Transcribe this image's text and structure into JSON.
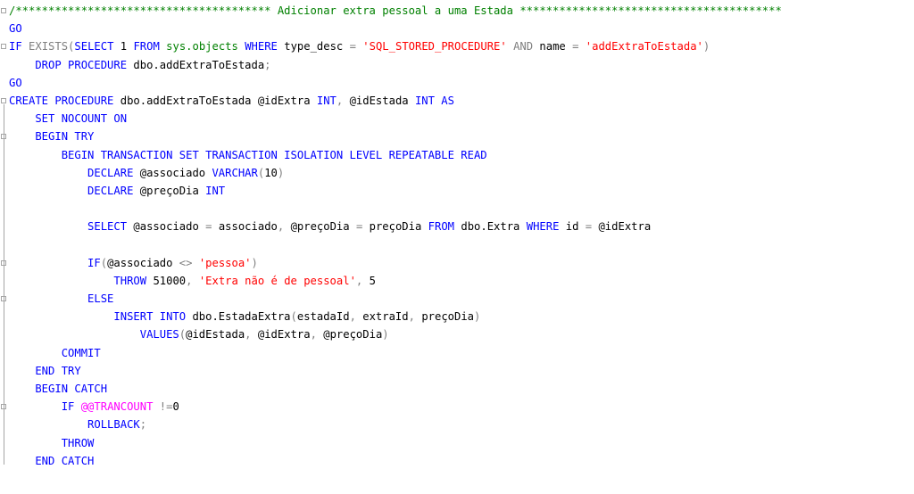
{
  "editor": {
    "lines": [
      [
        {
          "t": "/*************************************** Adicionar extra pessoal a uma Estada ****************************************",
          "c": "cmt"
        }
      ],
      [
        {
          "t": "GO",
          "c": "kw"
        }
      ],
      [
        {
          "t": "IF ",
          "c": "kw"
        },
        {
          "t": "EXISTS",
          "c": "gray"
        },
        {
          "t": "(",
          "c": "gray"
        },
        {
          "t": "SELECT ",
          "c": "kw"
        },
        {
          "t": "1 ",
          "c": "id"
        },
        {
          "t": "FROM ",
          "c": "kw"
        },
        {
          "t": "sys.objects ",
          "c": "sys"
        },
        {
          "t": "WHERE ",
          "c": "kw"
        },
        {
          "t": "type_desc ",
          "c": "id"
        },
        {
          "t": "= ",
          "c": "gray"
        },
        {
          "t": "'SQL_STORED_PROCEDURE' ",
          "c": "str"
        },
        {
          "t": "AND ",
          "c": "gray"
        },
        {
          "t": "name ",
          "c": "id"
        },
        {
          "t": "= ",
          "c": "gray"
        },
        {
          "t": "'addExtraToEstada'",
          "c": "str"
        },
        {
          "t": ")",
          "c": "gray"
        }
      ],
      [
        {
          "t": "    DROP PROCEDURE ",
          "c": "kw"
        },
        {
          "t": "dbo.addExtraToEstada",
          "c": "id"
        },
        {
          "t": ";",
          "c": "gray"
        }
      ],
      [
        {
          "t": "GO",
          "c": "kw"
        }
      ],
      [
        {
          "t": "CREATE PROCEDURE ",
          "c": "kw"
        },
        {
          "t": "dbo.addExtraToEstada @idExtra ",
          "c": "id"
        },
        {
          "t": "INT",
          "c": "kw"
        },
        {
          "t": ", ",
          "c": "gray"
        },
        {
          "t": "@idEstada ",
          "c": "id"
        },
        {
          "t": "INT AS",
          "c": "kw"
        }
      ],
      [
        {
          "t": "    SET NOCOUNT ON",
          "c": "kw"
        }
      ],
      [
        {
          "t": "    BEGIN TRY",
          "c": "kw"
        }
      ],
      [
        {
          "t": "        BEGIN TRANSACTION SET TRANSACTION ISOLATION LEVEL REPEATABLE READ",
          "c": "kw"
        }
      ],
      [
        {
          "t": "            DECLARE ",
          "c": "kw"
        },
        {
          "t": "@associado ",
          "c": "id"
        },
        {
          "t": "VARCHAR",
          "c": "kw"
        },
        {
          "t": "(",
          "c": "gray"
        },
        {
          "t": "10",
          "c": "id"
        },
        {
          "t": ")",
          "c": "gray"
        }
      ],
      [
        {
          "t": "            DECLARE ",
          "c": "kw"
        },
        {
          "t": "@preçoDia ",
          "c": "id"
        },
        {
          "t": "INT",
          "c": "kw"
        }
      ],
      [
        {
          "t": "",
          "c": "id"
        }
      ],
      [
        {
          "t": "            SELECT ",
          "c": "kw"
        },
        {
          "t": "@associado ",
          "c": "id"
        },
        {
          "t": "= ",
          "c": "gray"
        },
        {
          "t": "associado",
          "c": "id"
        },
        {
          "t": ", ",
          "c": "gray"
        },
        {
          "t": "@preçoDia ",
          "c": "id"
        },
        {
          "t": "= ",
          "c": "gray"
        },
        {
          "t": "preçoDia ",
          "c": "id"
        },
        {
          "t": "FROM ",
          "c": "kw"
        },
        {
          "t": "dbo.Extra ",
          "c": "id"
        },
        {
          "t": "WHERE ",
          "c": "kw"
        },
        {
          "t": "id ",
          "c": "id"
        },
        {
          "t": "= ",
          "c": "gray"
        },
        {
          "t": "@idExtra",
          "c": "id"
        }
      ],
      [
        {
          "t": "",
          "c": "id"
        }
      ],
      [
        {
          "t": "            IF",
          "c": "kw"
        },
        {
          "t": "(",
          "c": "gray"
        },
        {
          "t": "@associado ",
          "c": "id"
        },
        {
          "t": "<> ",
          "c": "gray"
        },
        {
          "t": "'pessoa'",
          "c": "str"
        },
        {
          "t": ")",
          "c": "gray"
        }
      ],
      [
        {
          "t": "                THROW ",
          "c": "kw"
        },
        {
          "t": "51000",
          "c": "id"
        },
        {
          "t": ", ",
          "c": "gray"
        },
        {
          "t": "'Extra não é de pessoal'",
          "c": "str"
        },
        {
          "t": ", ",
          "c": "gray"
        },
        {
          "t": "5",
          "c": "id"
        }
      ],
      [
        {
          "t": "            ELSE",
          "c": "kw"
        }
      ],
      [
        {
          "t": "                INSERT INTO ",
          "c": "kw"
        },
        {
          "t": "dbo.EstadaExtra",
          "c": "id"
        },
        {
          "t": "(",
          "c": "gray"
        },
        {
          "t": "estadaId",
          "c": "id"
        },
        {
          "t": ", ",
          "c": "gray"
        },
        {
          "t": "extraId",
          "c": "id"
        },
        {
          "t": ", ",
          "c": "gray"
        },
        {
          "t": "preçoDia",
          "c": "id"
        },
        {
          "t": ")",
          "c": "gray"
        }
      ],
      [
        {
          "t": "                    VALUES",
          "c": "kw"
        },
        {
          "t": "(",
          "c": "gray"
        },
        {
          "t": "@idEstada",
          "c": "id"
        },
        {
          "t": ", ",
          "c": "gray"
        },
        {
          "t": "@idExtra",
          "c": "id"
        },
        {
          "t": ", ",
          "c": "gray"
        },
        {
          "t": "@preçoDia",
          "c": "id"
        },
        {
          "t": ")",
          "c": "gray"
        }
      ],
      [
        {
          "t": "        COMMIT",
          "c": "kw"
        }
      ],
      [
        {
          "t": "    END TRY",
          "c": "kw"
        }
      ],
      [
        {
          "t": "    BEGIN CATCH",
          "c": "kw"
        }
      ],
      [
        {
          "t": "        IF ",
          "c": "kw"
        },
        {
          "t": "@@TRANCOUNT ",
          "c": "fn"
        },
        {
          "t": "!=",
          "c": "gray"
        },
        {
          "t": "0",
          "c": "id"
        }
      ],
      [
        {
          "t": "            ROLLBACK",
          "c": "kw"
        },
        {
          "t": ";",
          "c": "gray"
        }
      ],
      [
        {
          "t": "        THROW",
          "c": "kw"
        }
      ],
      [
        {
          "t": "    END CATCH",
          "c": "kw"
        }
      ]
    ]
  }
}
